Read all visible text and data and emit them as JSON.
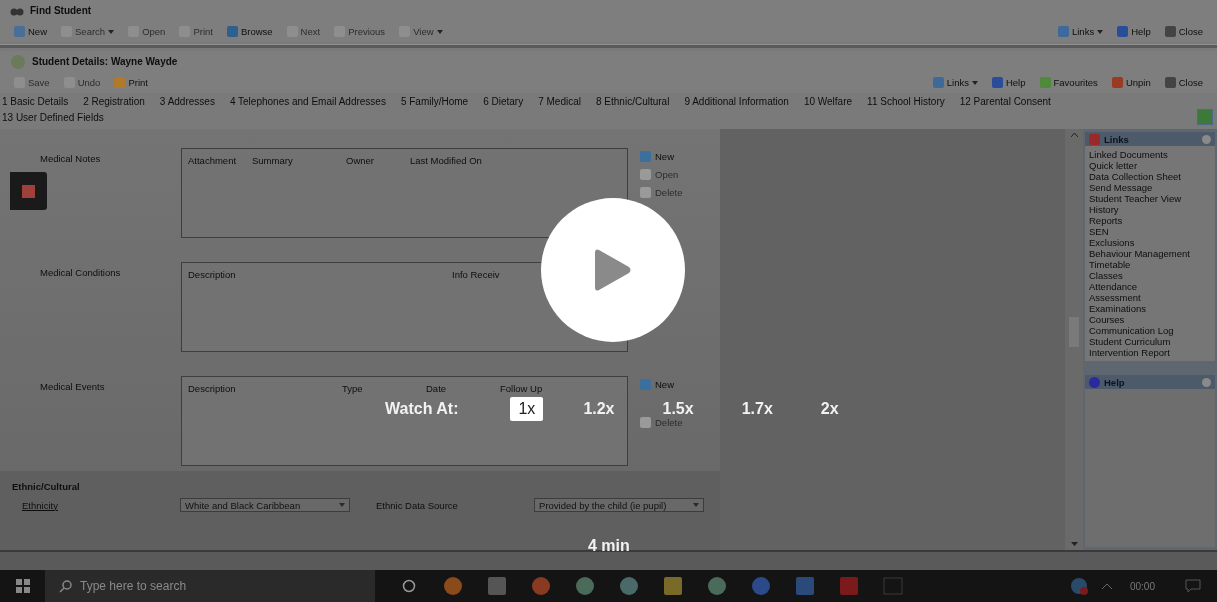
{
  "window": {
    "title": "Find Student"
  },
  "toolbar": {
    "items": [
      {
        "label": "New",
        "disabled": false
      },
      {
        "label": "Search",
        "disabled": true,
        "dropdown": true
      },
      {
        "label": "Open",
        "disabled": true
      },
      {
        "label": "Print",
        "disabled": true
      },
      {
        "label": "Browse",
        "disabled": false
      },
      {
        "label": "Next",
        "disabled": true
      },
      {
        "label": "Previous",
        "disabled": true
      },
      {
        "label": "View",
        "disabled": true,
        "dropdown": true
      }
    ],
    "right_items": [
      {
        "label": "Links",
        "dropdown": true
      },
      {
        "label": "Help"
      },
      {
        "label": "Close"
      }
    ]
  },
  "details": {
    "title": "Student Details: Wayne Wayde",
    "toolbar": [
      {
        "label": "Save",
        "disabled": true
      },
      {
        "label": "Undo",
        "disabled": true
      },
      {
        "label": "Print",
        "disabled": false
      }
    ],
    "right_items": [
      {
        "label": "Links",
        "dropdown": true
      },
      {
        "label": "Help"
      },
      {
        "label": "Favourites"
      },
      {
        "label": "Unpin"
      },
      {
        "label": "Close"
      }
    ],
    "tabs": [
      "1 Basic Details",
      "2 Registration",
      "3 Addresses",
      "4 Telephones and Email Addresses",
      "5 Family/Home",
      "6 Dietary",
      "7 Medical",
      "8 Ethnic/Cultural",
      "9 Additional Information",
      "10 Welfare",
      "11 School History",
      "12 Parental Consent",
      "13 User Defined Fields"
    ]
  },
  "sections": [
    {
      "label": "Medical Notes",
      "columns": [
        "Attachment",
        "Summary",
        "Owner",
        "Last Modified On"
      ],
      "buttons": [
        {
          "label": "New",
          "disabled": false
        },
        {
          "label": "Open",
          "disabled": true
        },
        {
          "label": "Delete",
          "disabled": true
        }
      ]
    },
    {
      "label": "Medical Conditions",
      "columns": [
        "Description",
        "Info Receiv"
      ]
    },
    {
      "label": "Medical Events",
      "columns": [
        "Description",
        "Type",
        "Date",
        "Follow Up"
      ],
      "buttons": [
        {
          "label": "New",
          "disabled": false
        },
        {
          "label": "Delete",
          "disabled": true
        }
      ]
    }
  ],
  "ethnic_cultural": {
    "heading": "Ethnic/Cultural",
    "fields": [
      {
        "label": "Ethnicity",
        "value": "White and Black Caribbean"
      },
      {
        "label": "Ethnic Data Source",
        "value": "Provided by the child (ie pupil)"
      }
    ]
  },
  "links_panel": {
    "title": "Links",
    "items": [
      "Linked Documents",
      "Quick letter",
      "Data Collection Sheet",
      "Send Message",
      "Student Teacher View",
      "History",
      "Reports",
      "SEN",
      "Exclusions",
      "Behaviour Management",
      "Timetable",
      "Classes",
      "Attendance",
      "Assessment",
      "Examinations",
      "Courses",
      "Communication Log",
      "Student Curriculum",
      "Intervention Report"
    ]
  },
  "help_panel": {
    "title": "Help"
  },
  "video": {
    "speed_label": "Watch At:",
    "speeds": [
      {
        "label": "1x",
        "selected": true
      },
      {
        "label": "1.2x",
        "selected": false
      },
      {
        "label": "1.5x",
        "selected": false
      },
      {
        "label": "1.7x",
        "selected": false
      },
      {
        "label": "2x",
        "selected": false
      }
    ],
    "duration": "4 min"
  },
  "taskbar": {
    "search": {
      "placeholder": "Type here to search"
    },
    "clock": "00:00"
  }
}
